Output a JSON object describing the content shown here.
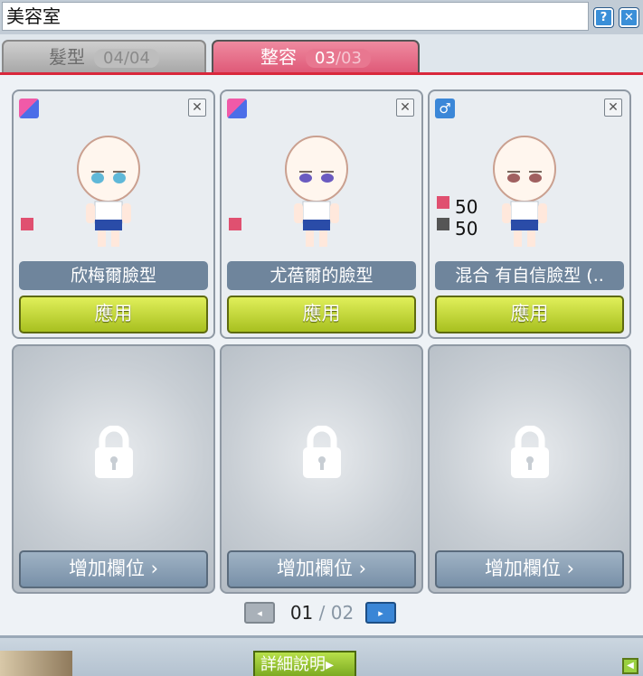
{
  "window": {
    "title": "美容室",
    "help_label": "?",
    "close_label": "✕"
  },
  "tabs": [
    {
      "label": "髮型",
      "current": "04",
      "max": "04",
      "active": false
    },
    {
      "label": "整容",
      "current": "03",
      "max": "03",
      "active": true
    }
  ],
  "faces": [
    {
      "gender": "both",
      "gender_icon": "female-male-icon",
      "name": "欣梅爾臉型",
      "apply_label": "應用",
      "mix": null
    },
    {
      "gender": "both",
      "gender_icon": "female-male-icon",
      "name": "尤蓓爾的臉型",
      "apply_label": "應用",
      "mix": null
    },
    {
      "gender": "male",
      "gender_icon": "male-icon",
      "name": "混合 有自信臉型 (..",
      "apply_label": "應用",
      "mix": {
        "pink": "50",
        "dark": "50"
      }
    }
  ],
  "locked_slots": [
    {
      "label": "增加欄位",
      "arrow": "›"
    },
    {
      "label": "增加欄位",
      "arrow": "›"
    },
    {
      "label": "增加欄位",
      "arrow": "›"
    }
  ],
  "pager": {
    "current": "01",
    "sep": "/",
    "total": "02",
    "prev": "◂",
    "next": "▸"
  },
  "bottom": {
    "detail_label": "詳細說明",
    "detail_arrow": "▸"
  },
  "colors": {
    "accent_red": "#d9283c",
    "apply_green": "#a8c020",
    "name_bar": "#6f859c"
  }
}
